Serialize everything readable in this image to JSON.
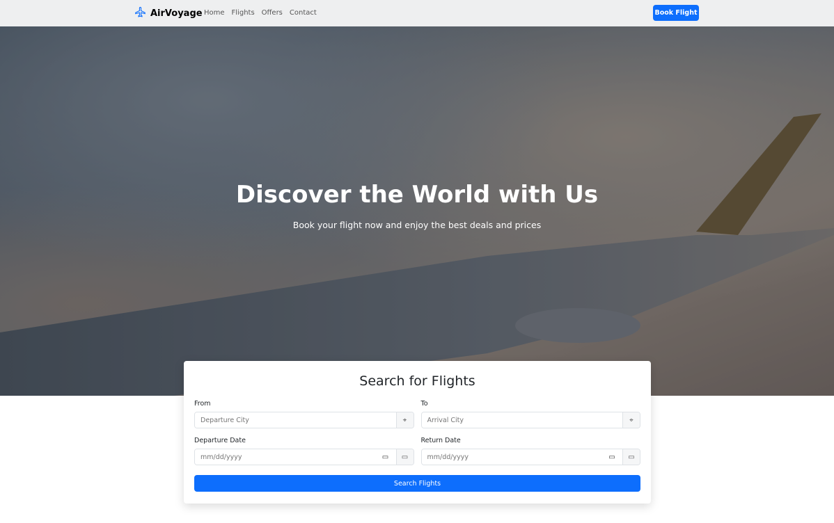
{
  "nav": {
    "brand": "AirVoyage",
    "links": [
      "Home",
      "Flights",
      "Offers",
      "Contact"
    ],
    "cta": "Book Flight"
  },
  "hero": {
    "title": "Discover the World with Us",
    "subtitle": "Book your flight now and enjoy the best deals and prices"
  },
  "search": {
    "title": "Search for Flights",
    "from": {
      "label": "From",
      "placeholder": "Departure City"
    },
    "to": {
      "label": "To",
      "placeholder": "Arrival City"
    },
    "departure": {
      "label": "Departure Date",
      "placeholder": "mm/dd/yyyy"
    },
    "return": {
      "label": "Return Date",
      "placeholder": "mm/dd/yyyy"
    },
    "button": "Search Flights"
  },
  "colors": {
    "primary": "#0d6efd"
  }
}
